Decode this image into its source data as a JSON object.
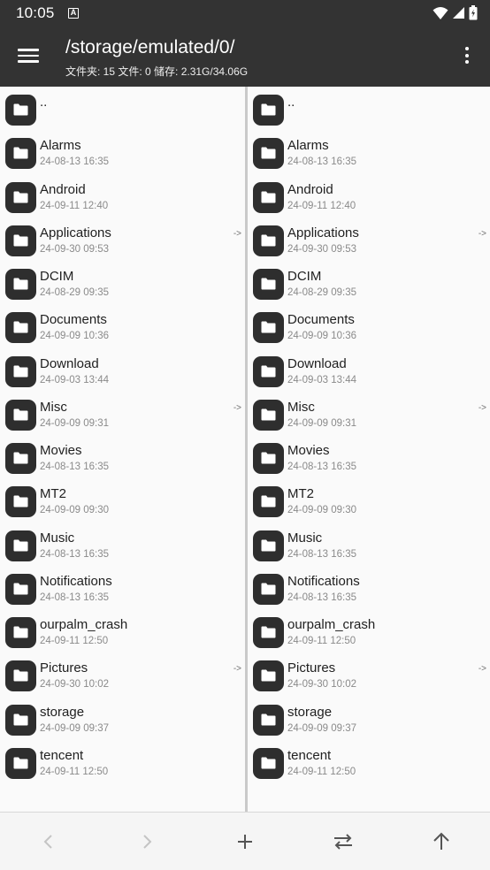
{
  "status": {
    "time": "10:05"
  },
  "header": {
    "path": "/storage/emulated/0/",
    "summary": "文件夹: 15  文件: 0  储存: 2.31G/34.06G"
  },
  "left_pane": {
    "items": [
      {
        "name": "..",
        "date": "",
        "arrow": ""
      },
      {
        "name": "Alarms",
        "date": "24-08-13 16:35",
        "arrow": ""
      },
      {
        "name": "Android",
        "date": "24-09-11 12:40",
        "arrow": ""
      },
      {
        "name": "Applications",
        "date": "24-09-30 09:53",
        "arrow": "->"
      },
      {
        "name": "DCIM",
        "date": "24-08-29 09:35",
        "arrow": ""
      },
      {
        "name": "Documents",
        "date": "24-09-09 10:36",
        "arrow": ""
      },
      {
        "name": "Download",
        "date": "24-09-03 13:44",
        "arrow": ""
      },
      {
        "name": "Misc",
        "date": "24-09-09 09:31",
        "arrow": "->"
      },
      {
        "name": "Movies",
        "date": "24-08-13 16:35",
        "arrow": ""
      },
      {
        "name": "MT2",
        "date": "24-09-09 09:30",
        "arrow": ""
      },
      {
        "name": "Music",
        "date": "24-08-13 16:35",
        "arrow": ""
      },
      {
        "name": "Notifications",
        "date": "24-08-13 16:35",
        "arrow": ""
      },
      {
        "name": "ourpalm_crash",
        "date": "24-09-11 12:50",
        "arrow": ""
      },
      {
        "name": "Pictures",
        "date": "24-09-30 10:02",
        "arrow": "->"
      },
      {
        "name": "storage",
        "date": "24-09-09 09:37",
        "arrow": ""
      },
      {
        "name": "tencent",
        "date": "24-09-11 12:50",
        "arrow": ""
      }
    ]
  },
  "right_pane": {
    "items": [
      {
        "name": "..",
        "date": "",
        "arrow": ""
      },
      {
        "name": "Alarms",
        "date": "24-08-13 16:35",
        "arrow": ""
      },
      {
        "name": "Android",
        "date": "24-09-11 12:40",
        "arrow": ""
      },
      {
        "name": "Applications",
        "date": "24-09-30 09:53",
        "arrow": "->"
      },
      {
        "name": "DCIM",
        "date": "24-08-29 09:35",
        "arrow": ""
      },
      {
        "name": "Documents",
        "date": "24-09-09 10:36",
        "arrow": ""
      },
      {
        "name": "Download",
        "date": "24-09-03 13:44",
        "arrow": ""
      },
      {
        "name": "Misc",
        "date": "24-09-09 09:31",
        "arrow": "->"
      },
      {
        "name": "Movies",
        "date": "24-08-13 16:35",
        "arrow": ""
      },
      {
        "name": "MT2",
        "date": "24-09-09 09:30",
        "arrow": ""
      },
      {
        "name": "Music",
        "date": "24-08-13 16:35",
        "arrow": ""
      },
      {
        "name": "Notifications",
        "date": "24-08-13 16:35",
        "arrow": ""
      },
      {
        "name": "ourpalm_crash",
        "date": "24-09-11 12:50",
        "arrow": ""
      },
      {
        "name": "Pictures",
        "date": "24-09-30 10:02",
        "arrow": "->"
      },
      {
        "name": "storage",
        "date": "24-09-09 09:37",
        "arrow": ""
      },
      {
        "name": "tencent",
        "date": "24-09-11 12:50",
        "arrow": ""
      }
    ]
  },
  "bottom_bar": {
    "buttons": [
      {
        "icon": "chevron-left-icon",
        "enabled": false
      },
      {
        "icon": "chevron-right-icon",
        "enabled": false
      },
      {
        "icon": "plus-icon",
        "enabled": true
      },
      {
        "icon": "swap-icon",
        "enabled": true
      },
      {
        "icon": "arrow-up-icon",
        "enabled": true
      }
    ]
  },
  "colors": {
    "appbar": "#333333",
    "folder_icon_bg": "#2e2e2e",
    "disabled_icon": "#c4c4c4",
    "enabled_icon": "#555555"
  }
}
